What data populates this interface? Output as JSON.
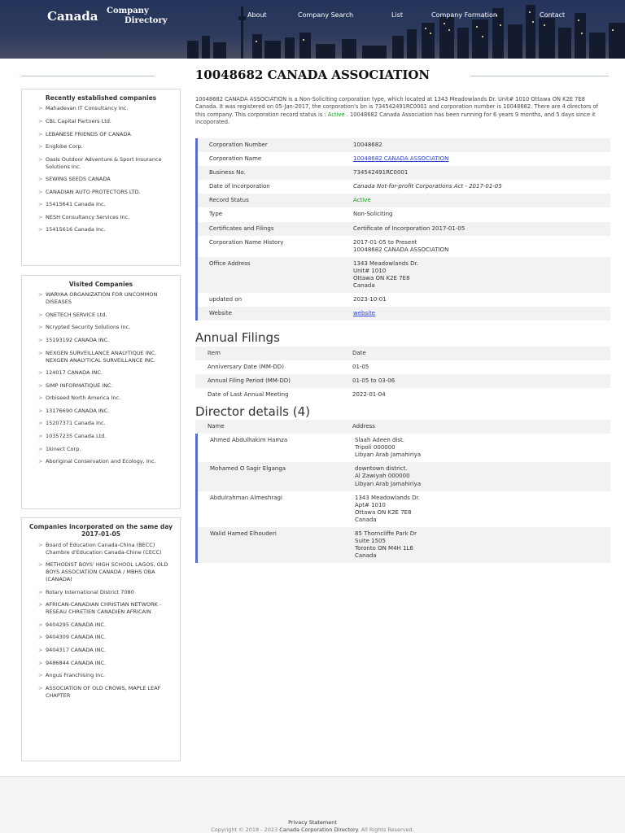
{
  "header": {
    "logo_main": "Canada",
    "logo_line1": "Company",
    "logo_line2": "Directory",
    "nav": [
      "About",
      "Company Search",
      "List",
      "Company Formation",
      "Contact"
    ]
  },
  "page_title": "10048682 CANADA ASSOCIATION",
  "intro": {
    "text_before": "10048682 CANADA ASSOCIATION is a Non-Soliciting corporation type, which located at 1343 Meadowlands Dr. Unit# 1010 Ottawa ON K2E 7E8 Canada. It was registered on 05-Jan-2017, the corporation's bn is 734542491RC0001 and corporation number is 10048682. There are 4 directors of this company. This corporation record status is :",
    "status": "Active",
    "text_after": ". 10048682 Canada Association has been running for 6 years 9 months, and 5 days since it incoporated."
  },
  "corporation": [
    {
      "key": "Corporation Number",
      "value": "10048682"
    },
    {
      "key": "Corporation Name",
      "value": "10048682 CANADA ASSOCIATION",
      "style": "link"
    },
    {
      "key": "Business No.",
      "value": "734542491RC0001"
    },
    {
      "key": "Date of Incorporation",
      "value": "Canada Not-for-profit Corporations Act - 2017-01-05",
      "style": "italic"
    },
    {
      "key": "Record Status",
      "value": "Active",
      "style": "active"
    },
    {
      "key": "Type",
      "value": "Non-Soliciting"
    },
    {
      "key": "Certificates and Filings",
      "value": "Certificate of Incorporation     2017-01-05"
    },
    {
      "key": "Corporation Name History",
      "value": "2017-01-05 to Present\n10048682 CANADA ASSOCIATION"
    },
    {
      "key": "Office Address",
      "value": "1343 Meadowlands Dr.\nUnit# 1010\nOttawa ON K2E 7E8\nCanada"
    },
    {
      "key": "updated on",
      "value": "2023-10-01"
    },
    {
      "key": "Website",
      "value": "website",
      "style": "link"
    }
  ],
  "annual_filings": {
    "heading": "Annual Filings",
    "col_item": "Item",
    "col_date": "Date",
    "rows": [
      {
        "item": "Anniversary Date (MM-DD)",
        "date": "01-05"
      },
      {
        "item": "Annual Filing Period (MM-DD)",
        "date": "01-05 to 03-06"
      },
      {
        "item": "Date of Last Annual Meeting",
        "date": "2022-01-04"
      }
    ]
  },
  "directors": {
    "heading": "Director details (4)",
    "col_name": "Name",
    "col_address": "Address",
    "rows": [
      {
        "name": "Ahmed Abdulhakim Hamza",
        "address": "Slaah Adeen dist.\nTripoli 000000\nLibyan Arab Jamahiriya"
      },
      {
        "name": "Mohamed O Sagir Elganga",
        "address": "downtown district.\nAl Zawiyah 000000\nLibyan Arab Jamahiriya"
      },
      {
        "name": "Abdulrahman Almeshragi",
        "address": "1343 Meadowlands Dr.\nApt# 1010\nOttawa ON K2E 7E8\nCanada"
      },
      {
        "name": "Walid Hamed Elhouderi",
        "address": "85 Thorncliffe Park Dr\nSuite 1505\nToronto ON M4H 1L6\nCanada"
      }
    ]
  },
  "sidebar": {
    "recent": {
      "heading": "Recently established companies",
      "items": [
        "Mahadevan IT Consultancy Inc.",
        "CBL Capital Partners Ltd.",
        "LEBANESE FRIENDS OF CANADA",
        "Englobe Corp.",
        "Oasis Outdoor Adventure & Sport Insurance Solutions Inc.",
        "SEWING SEEDS CANADA",
        "CANADIAN AUTO PROTECTORS LTD.",
        "15415641 Canada Inc.",
        "NESH Consultancy Services Inc.",
        "15415616 Canada Inc."
      ]
    },
    "visited": {
      "heading": "Visited Companies",
      "items": [
        "WARYAA ORGANIZATION FOR UNCOMMON DISEASES",
        "ONETECH SERVICE Ltd.",
        "Ncrypted Security Solutions Inc.",
        "15193192 CANADA INC.",
        "NEXGEN SURVEILLANCE ANALYTIQUE INC.\nNEXGEN ANALYTICAL SURVEILLANCE INC.",
        "124017 CANADA INC.",
        "SIMP INFORMATIQUE INC.",
        "Orbiseed North America Inc.",
        "13176690 CANADA INC.",
        "15207371 Canada Inc.",
        "10357235 Canada Ltd.",
        "1kinect Corp.",
        "Aboriginal Conservation and Ecology, Inc."
      ]
    },
    "sameday": {
      "heading": "Companies incorporated on the same day",
      "date": "2017-01-05",
      "items": [
        "Board of Education Canada-China (BECC)\nChambre d'Education Canada-Chine (CECC)",
        "METHODIST BOYS' HIGH SCHOOL LAGOS, OLD BOYS ASSOCIATION CANADA / MBHS OBA (CANADA)",
        "Rotary International District 7080",
        "AFRICAN-CANADIAN CHRISTIAN NETWORK - RESEAU CHRETIEN CANADIEN AFRICAIN",
        "9404295 CANADA INC.",
        "9404309 CANADA INC.",
        "9404317 CANADA INC.",
        "9486844 CANADA INC.",
        "Angus Franchising Inc.",
        "ASSOCIATION OF OLD CROWS, MAPLE LEAF CHAPTER"
      ]
    }
  },
  "footer": {
    "privacy": "Privacy Statement",
    "copyright_prefix": "Copyright © 2018 - 2023",
    "copyright_link": "Canada Corporation Directory",
    "copyright_suffix": ". All Rights Reserved."
  }
}
